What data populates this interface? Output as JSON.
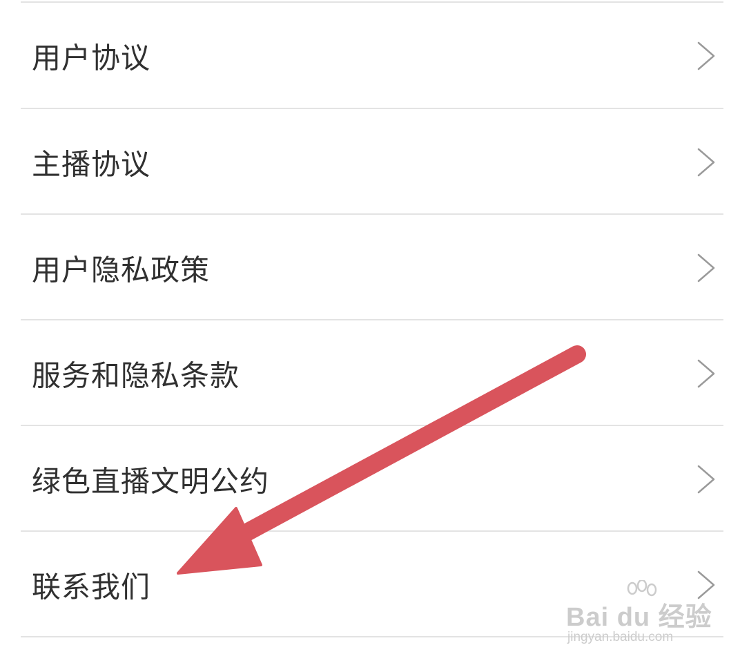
{
  "menu": {
    "items": [
      {
        "label": "用户协议",
        "icon": "chevron-right-icon"
      },
      {
        "label": "主播协议",
        "icon": "chevron-right-icon"
      },
      {
        "label": "用户隐私政策",
        "icon": "chevron-right-icon"
      },
      {
        "label": "服务和隐私条款",
        "icon": "chevron-right-icon"
      },
      {
        "label": "绿色直播文明公约",
        "icon": "chevron-right-icon"
      },
      {
        "label": "联系我们",
        "icon": "chevron-right-icon"
      }
    ]
  },
  "annotation": {
    "arrow_color": "#d9545c",
    "points_to": "联系我们"
  },
  "watermark": {
    "logo": "Bai du 经验",
    "url": "jingyan.baidu.com"
  },
  "colors": {
    "text": "#303030",
    "divider": "#e3e3e3",
    "chevron": "#9a9a9a"
  }
}
